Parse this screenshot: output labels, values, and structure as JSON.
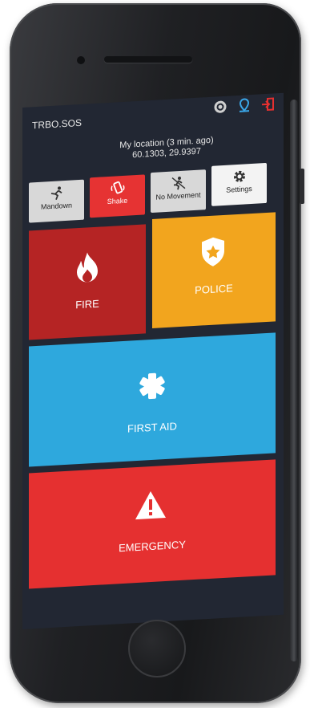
{
  "app": {
    "title": "TRBO.SOS"
  },
  "header_icons": [
    "sync-icon",
    "location-pin-icon",
    "logout-icon"
  ],
  "location": {
    "line1": "My location (3 min. ago)",
    "line2": "60.1303, 29.9397"
  },
  "modes": [
    {
      "label": "Mandown",
      "icon": "falling-person-icon"
    },
    {
      "label": "Shake",
      "icon": "shake-phone-icon"
    },
    {
      "label": "No Movement",
      "icon": "no-movement-icon"
    },
    {
      "label": "Settings",
      "icon": "gear-icon"
    }
  ],
  "tiles": {
    "fire": {
      "label": "FIRE",
      "icon": "flame-icon"
    },
    "police": {
      "label": "POLICE",
      "icon": "police-badge-icon"
    },
    "first_aid": {
      "label": "FIRST AID",
      "icon": "medical-star-icon"
    },
    "emergency": {
      "label": "EMERGENCY",
      "icon": "warning-triangle-icon"
    }
  },
  "colors": {
    "screen_bg": "#222733",
    "fire": "#b52424",
    "police": "#f2a51e",
    "first_aid": "#2ea8dd",
    "emergency": "#e53030",
    "shake_active": "#e63333"
  }
}
